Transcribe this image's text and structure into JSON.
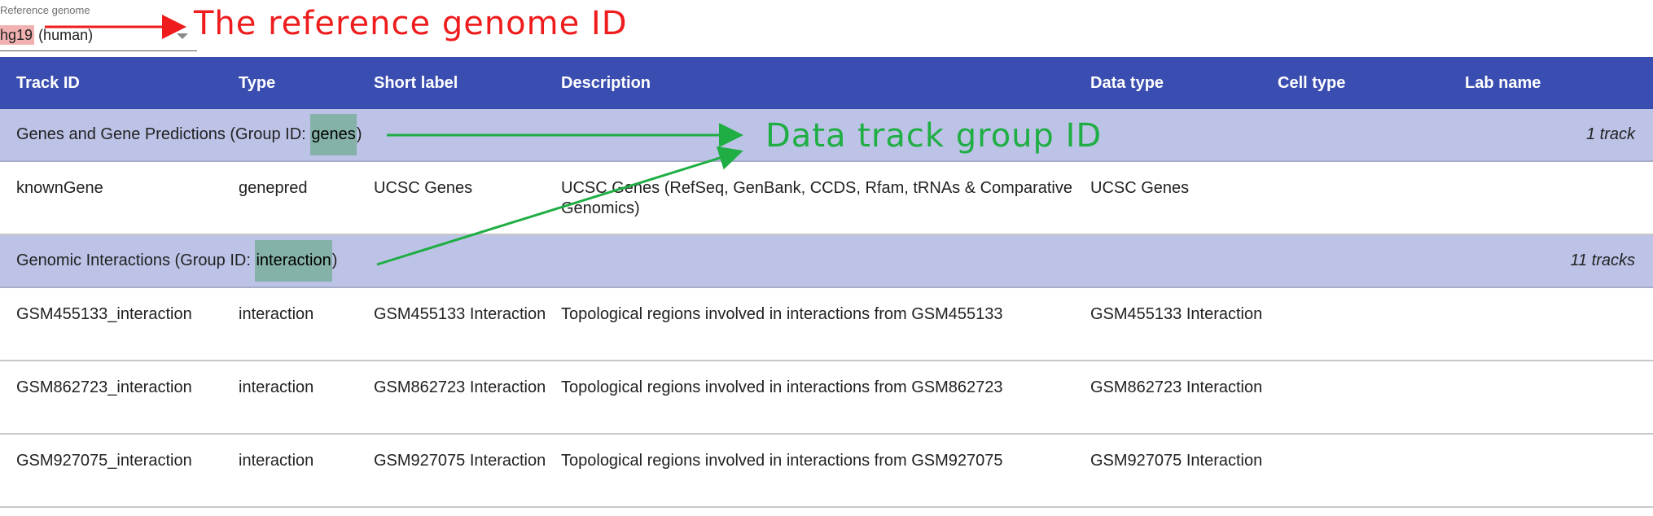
{
  "reference_genome": {
    "label": "Reference genome",
    "id": "hg19",
    "name": "(human)"
  },
  "annotations": {
    "ref_note": "The reference genome ID",
    "group_note": "Data track group ID"
  },
  "table": {
    "headers": [
      "Track ID",
      "Type",
      "Short label",
      "Description",
      "Data type",
      "Cell type",
      "Lab name"
    ],
    "groups": [
      {
        "title_prefix": "Genes and Gene Predictions (Group ID: ",
        "group_id": "genes",
        "title_suffix": ")",
        "count": "1 track",
        "rows": [
          {
            "track_id": "knownGene",
            "type": "genepred",
            "short_label": "UCSC Genes",
            "description": "UCSC Genes (RefSeq, GenBank, CCDS, Rfam, tRNAs & Comparative Genomics)",
            "data_type": "UCSC Genes",
            "cell_type": "",
            "lab_name": ""
          }
        ]
      },
      {
        "title_prefix": "Genomic Interactions (Group ID: ",
        "group_id": "interaction",
        "title_suffix": ")",
        "count": "11 tracks",
        "rows": [
          {
            "track_id": "GSM455133_interaction",
            "type": "interaction",
            "short_label": "GSM455133 Interaction",
            "description": "Topological regions involved in interactions from GSM455133",
            "data_type": "GSM455133 Interaction",
            "cell_type": "",
            "lab_name": ""
          },
          {
            "track_id": "GSM862723_interaction",
            "type": "interaction",
            "short_label": "GSM862723 Interaction",
            "description": "Topological regions involved in interactions from GSM862723",
            "data_type": "GSM862723 Interaction",
            "cell_type": "",
            "lab_name": ""
          },
          {
            "track_id": "GSM927075_interaction",
            "type": "interaction",
            "short_label": "GSM927075 Interaction",
            "description": "Topological regions involved in interactions from GSM927075",
            "data_type": "GSM927075 Interaction",
            "cell_type": "",
            "lab_name": ""
          }
        ]
      }
    ]
  },
  "colors": {
    "header_bg": "#3a4db0",
    "group_bg": "#bdc3e7",
    "annotation_red": "#ee1c1c",
    "annotation_green": "#1fae44",
    "ref_highlight": "#f2b1b1",
    "group_id_highlight": "#84b2a8"
  }
}
